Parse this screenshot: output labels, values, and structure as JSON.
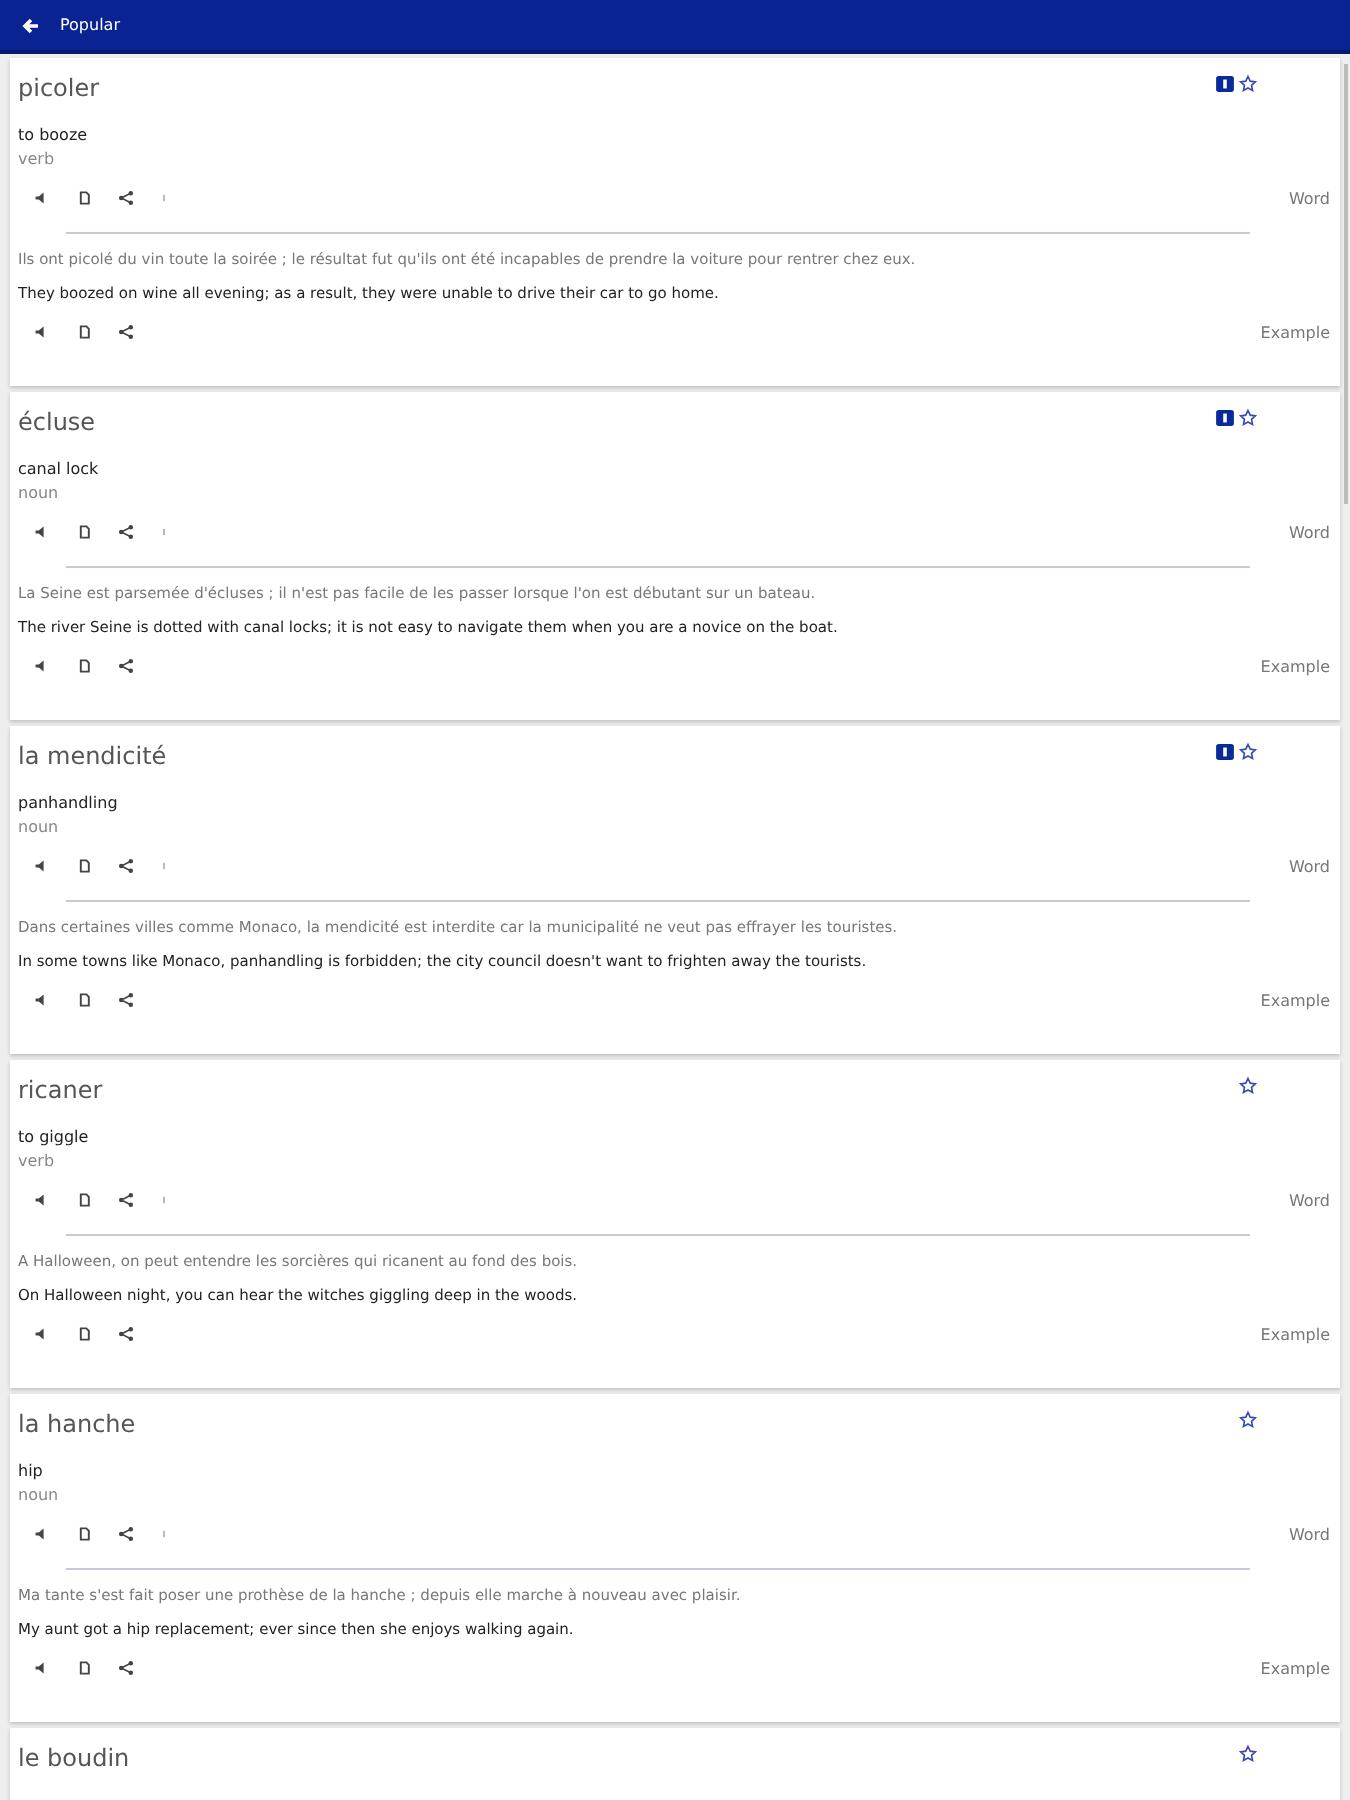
{
  "app_bar": {
    "title": "Popular"
  },
  "entries": [
    {
      "word": "picoler",
      "badge": true,
      "translation": "to booze",
      "pos": "verb",
      "word_label": "Word",
      "example_fr": "Ils ont picolé du vin toute la soirée ; le résultat fut qu'ils ont été incapables de prendre la voiture pour rentrer chez eux.",
      "example_en": "They boozed on wine all evening; as a result, they were unable to drive their car to go home.",
      "example_label": "Example"
    },
    {
      "word": "écluse",
      "badge": true,
      "translation": "canal lock",
      "pos": "noun",
      "word_label": "Word",
      "example_fr": "La Seine est parsemée d'écluses ; il n'est pas facile de les passer lorsque l'on est débutant sur un bateau.",
      "example_en": "The river Seine is dotted with canal locks; it is not easy to navigate them when you are a novice on the boat.",
      "example_label": "Example"
    },
    {
      "word": "la mendicité",
      "badge": true,
      "translation": "panhandling",
      "pos": "noun",
      "word_label": "Word",
      "example_fr": "Dans certaines villes comme Monaco, la mendicité est interdite car la municipalité ne veut pas effrayer les touristes.",
      "example_en": "In some towns like Monaco, panhandling is forbidden; the city council doesn't want to frighten away the tourists.",
      "example_label": "Example"
    },
    {
      "word": "ricaner",
      "badge": false,
      "translation": "to giggle",
      "pos": "verb",
      "word_label": "Word",
      "example_fr": "A Halloween, on peut entendre les sorcières qui ricanent au fond des bois.",
      "example_en": "On Halloween night, you can hear the witches giggling deep in the woods.",
      "example_label": "Example"
    },
    {
      "word": "la hanche",
      "badge": false,
      "translation": "hip",
      "pos": "noun",
      "word_label": "Word",
      "example_fr": "Ma tante s'est fait poser une prothèse de la hanche ; depuis elle marche à nouveau avec plaisir.",
      "example_en": "My aunt got a hip replacement; ever since then she enjoys walking again.",
      "example_label": "Example"
    },
    {
      "word": "le boudin",
      "badge": false
    }
  ]
}
